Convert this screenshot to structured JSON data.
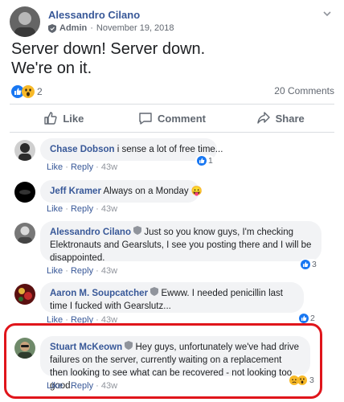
{
  "post": {
    "author": "Alessandro Cilano",
    "role": "Admin",
    "date": "November 19, 2018",
    "dot": "·",
    "text_line1": "Server down! Server down.",
    "text_line2": "We're on it.",
    "reaction_count": "2",
    "comments_count": "20 Comments",
    "reactions": [
      "like-icon",
      "wow-icon"
    ]
  },
  "actions": {
    "like": "Like",
    "comment": "Comment",
    "share": "Share"
  },
  "comments": [
    {
      "name": "Chase Dobson",
      "text": "i sense a lot of free time...",
      "like": "Like",
      "reply": "Reply",
      "age": "43w",
      "reaction_count": "1"
    },
    {
      "name": "Jeff Kramer",
      "text": "Always on a Monday",
      "emoji": "😛",
      "like": "Like",
      "reply": "Reply",
      "age": "43w"
    },
    {
      "name": "Alessandro Cilano",
      "text": "Just so you know guys, I'm checking Elektronauts and Gearsluts, I see you posting there and I will be disappointed.",
      "like": "Like",
      "reply": "Reply",
      "age": "43w",
      "reaction_count": "3"
    },
    {
      "name": "Aaron M. Soupcatcher",
      "text": "Ewww. I needed penicillin last time I fucked with Gearslutz...",
      "like": "Like",
      "reply": "Reply",
      "age": "43w",
      "reaction_count": "2"
    },
    {
      "name": "Stuart McKeown",
      "text": "Hey guys, unfortunately we've had drive failures on the server, currently waiting on a replacement then looking to see what can be recovered - not looking too good.",
      "like": "Like",
      "reply": "Reply",
      "age": "43w",
      "reaction_count": "3"
    }
  ],
  "colors": {
    "link": "#385898",
    "like_blue": "#1877f2",
    "highlight": "#e0151b"
  }
}
